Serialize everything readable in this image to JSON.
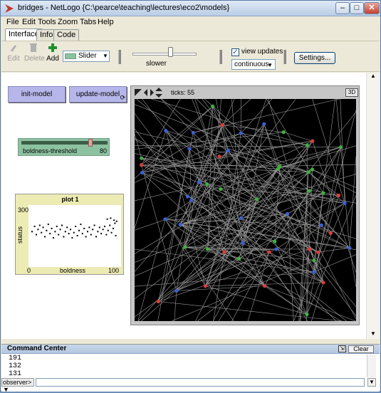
{
  "window": {
    "title": "bridges - NetLogo {C:\\pearce\\teaching\\lectures\\eco2\\models}"
  },
  "menu": [
    "File",
    "Edit",
    "Tools",
    "Zoom",
    "Tabs",
    "Help"
  ],
  "tabs": [
    "Interface",
    "Info",
    "Code"
  ],
  "toolbar": {
    "edit_label": "Edit",
    "delete_label": "Delete",
    "add_label": "Add",
    "widget_type": "Slider",
    "speed_label": "slower",
    "view_updates_label": "view updates",
    "view_updates_checked": true,
    "update_mode": "continuous",
    "settings_label": "Settings..."
  },
  "buttons": {
    "init": "init-model",
    "update": "update-model"
  },
  "slider": {
    "name": "boldness-threshold",
    "value": "80",
    "fraction": 0.8
  },
  "plot": {
    "title": "plot 1",
    "ylabel": "status",
    "xlabel": "boldness",
    "y_max_label": "300",
    "x_min_label": "0",
    "x_max_label": "100"
  },
  "chart_data": {
    "type": "scatter",
    "title": "plot 1",
    "xlabel": "boldness",
    "ylabel": "status",
    "xlim": [
      0,
      100
    ],
    "ylim": [
      0,
      300
    ],
    "series": [
      {
        "values": [
          [
            0,
            175
          ],
          [
            3,
            200
          ],
          [
            5,
            160
          ],
          [
            7,
            185
          ],
          [
            9,
            205
          ],
          [
            11,
            170
          ],
          [
            13,
            195
          ],
          [
            15,
            150
          ],
          [
            17,
            180
          ],
          [
            19,
            210
          ],
          [
            21,
            165
          ],
          [
            23,
            190
          ],
          [
            25,
            145
          ],
          [
            27,
            175
          ],
          [
            29,
            200
          ],
          [
            31,
            160
          ],
          [
            33,
            185
          ],
          [
            35,
            205
          ],
          [
            37,
            150
          ],
          [
            39,
            175
          ],
          [
            41,
            195
          ],
          [
            43,
            165
          ],
          [
            45,
            185
          ],
          [
            47,
            145
          ],
          [
            49,
            170
          ],
          [
            51,
            200
          ],
          [
            53,
            155
          ],
          [
            55,
            180
          ],
          [
            57,
            210
          ],
          [
            59,
            165
          ],
          [
            61,
            190
          ],
          [
            63,
            150
          ],
          [
            65,
            175
          ],
          [
            67,
            195
          ],
          [
            69,
            160
          ],
          [
            71,
            185
          ],
          [
            73,
            205
          ],
          [
            75,
            150
          ],
          [
            77,
            175
          ],
          [
            79,
            195
          ],
          [
            81,
            165
          ],
          [
            83,
            185
          ],
          [
            85,
            200
          ],
          [
            87,
            160
          ],
          [
            89,
            180
          ],
          [
            91,
            205
          ],
          [
            93,
            170
          ],
          [
            95,
            190
          ],
          [
            97,
            215
          ],
          [
            98,
            155
          ],
          [
            88,
            235
          ],
          [
            92,
            240
          ],
          [
            96,
            230
          ],
          [
            99,
            225
          ]
        ]
      }
    ]
  },
  "view": {
    "ticks_label": "ticks: 55",
    "three_d_label": "3D"
  },
  "network": {
    "color_red": "#e03a3a",
    "color_green": "#3fb23f",
    "color_blue": "#3a5fd6",
    "link_color": "#9a9a9a"
  },
  "command_center": {
    "title": "Command Center",
    "clear_label": "Clear",
    "output": [
      "191",
      "132",
      "131"
    ],
    "prompt": "observer>"
  }
}
